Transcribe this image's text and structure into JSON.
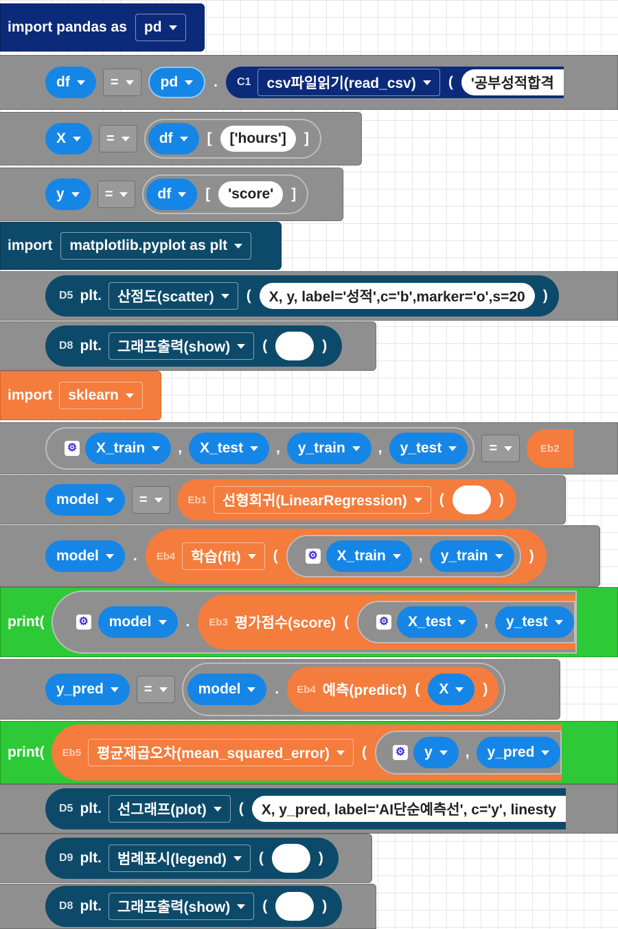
{
  "blocks": {
    "b1": {
      "keyword": "import pandas as",
      "module": "pd"
    },
    "b2": {
      "var": "df",
      "op": "=",
      "obj": "pd",
      "dot": ".",
      "tag": "C1",
      "func": "csv파일읽기(read_csv)",
      "paren_open": "(",
      "arg": "'공부성적합격"
    },
    "b3": {
      "var": "X",
      "op": "=",
      "obj": "df",
      "bracket_open": "[",
      "arg": "['hours']",
      "bracket_close": "]"
    },
    "b4": {
      "var": "y",
      "op": "=",
      "obj": "df",
      "bracket_open": "[",
      "arg": "'score'",
      "bracket_close": "]"
    },
    "b5": {
      "keyword": "import",
      "module": "matplotlib.pyplot as plt"
    },
    "b6": {
      "tag": "D5",
      "obj": "plt.",
      "func": "산점도(scatter)",
      "paren_open": "(",
      "arg": "X, y, label='성적',c='b',marker='o',s=20",
      "paren_close": ")"
    },
    "b7": {
      "tag": "D8",
      "obj": "plt.",
      "func": "그래프출력(show)",
      "paren_open": "(",
      "paren_close": ")"
    },
    "b8": {
      "keyword": "import",
      "module": "sklearn"
    },
    "b9": {
      "items": [
        "X_train",
        "X_test",
        "y_train",
        "y_test"
      ],
      "comma": ",",
      "op": "=",
      "tag": "Eb2"
    },
    "b10": {
      "var": "model",
      "op": "=",
      "tag": "Eb1",
      "func": "선형회귀(LinearRegression)",
      "paren_open": "(",
      "paren_close": ")"
    },
    "b11": {
      "var": "model",
      "dot": ".",
      "tag": "Eb4",
      "func": "학습(fit)",
      "paren_open": "(",
      "args": [
        "X_train",
        "y_train"
      ],
      "comma": ",",
      "paren_close": ")"
    },
    "b12": {
      "keyword": "print(",
      "obj": "model",
      "dot": ".",
      "tag": "Eb3",
      "func": "평가점수(score)",
      "paren_open": "(",
      "args": [
        "X_test",
        "y_test"
      ],
      "comma": ","
    },
    "b13": {
      "var": "y_pred",
      "op": "=",
      "obj": "model",
      "dot": ".",
      "tag": "Eb4",
      "func": "예측(predict)",
      "paren_open": "(",
      "arg": "X",
      "paren_close": ")"
    },
    "b14": {
      "keyword": "print(",
      "tag": "Eb5",
      "func": "평균제곱오차(mean_squared_error)",
      "paren_open": "(",
      "args": [
        "y",
        "y_pred"
      ],
      "comma": ","
    },
    "b15": {
      "tag": "D5",
      "obj": "plt.",
      "func": "선그래프(plot)",
      "paren_open": "(",
      "arg": "X, y_pred, label='AI단순예측선', c='y', linesty"
    },
    "b16": {
      "tag": "D9",
      "obj": "plt.",
      "func": "범례표시(legend)",
      "paren_open": "(",
      "paren_close": ")"
    },
    "b17": {
      "tag": "D8",
      "obj": "plt.",
      "func": "그래프출력(show)",
      "paren_open": "(",
      "paren_close": ")"
    }
  },
  "colors": {
    "navy": "#0b2a7a",
    "teal": "#0d4a6a",
    "orange": "#f47c3c",
    "green": "#2ec936",
    "blue": "#1686e6",
    "gray": "#8f8f8f"
  }
}
